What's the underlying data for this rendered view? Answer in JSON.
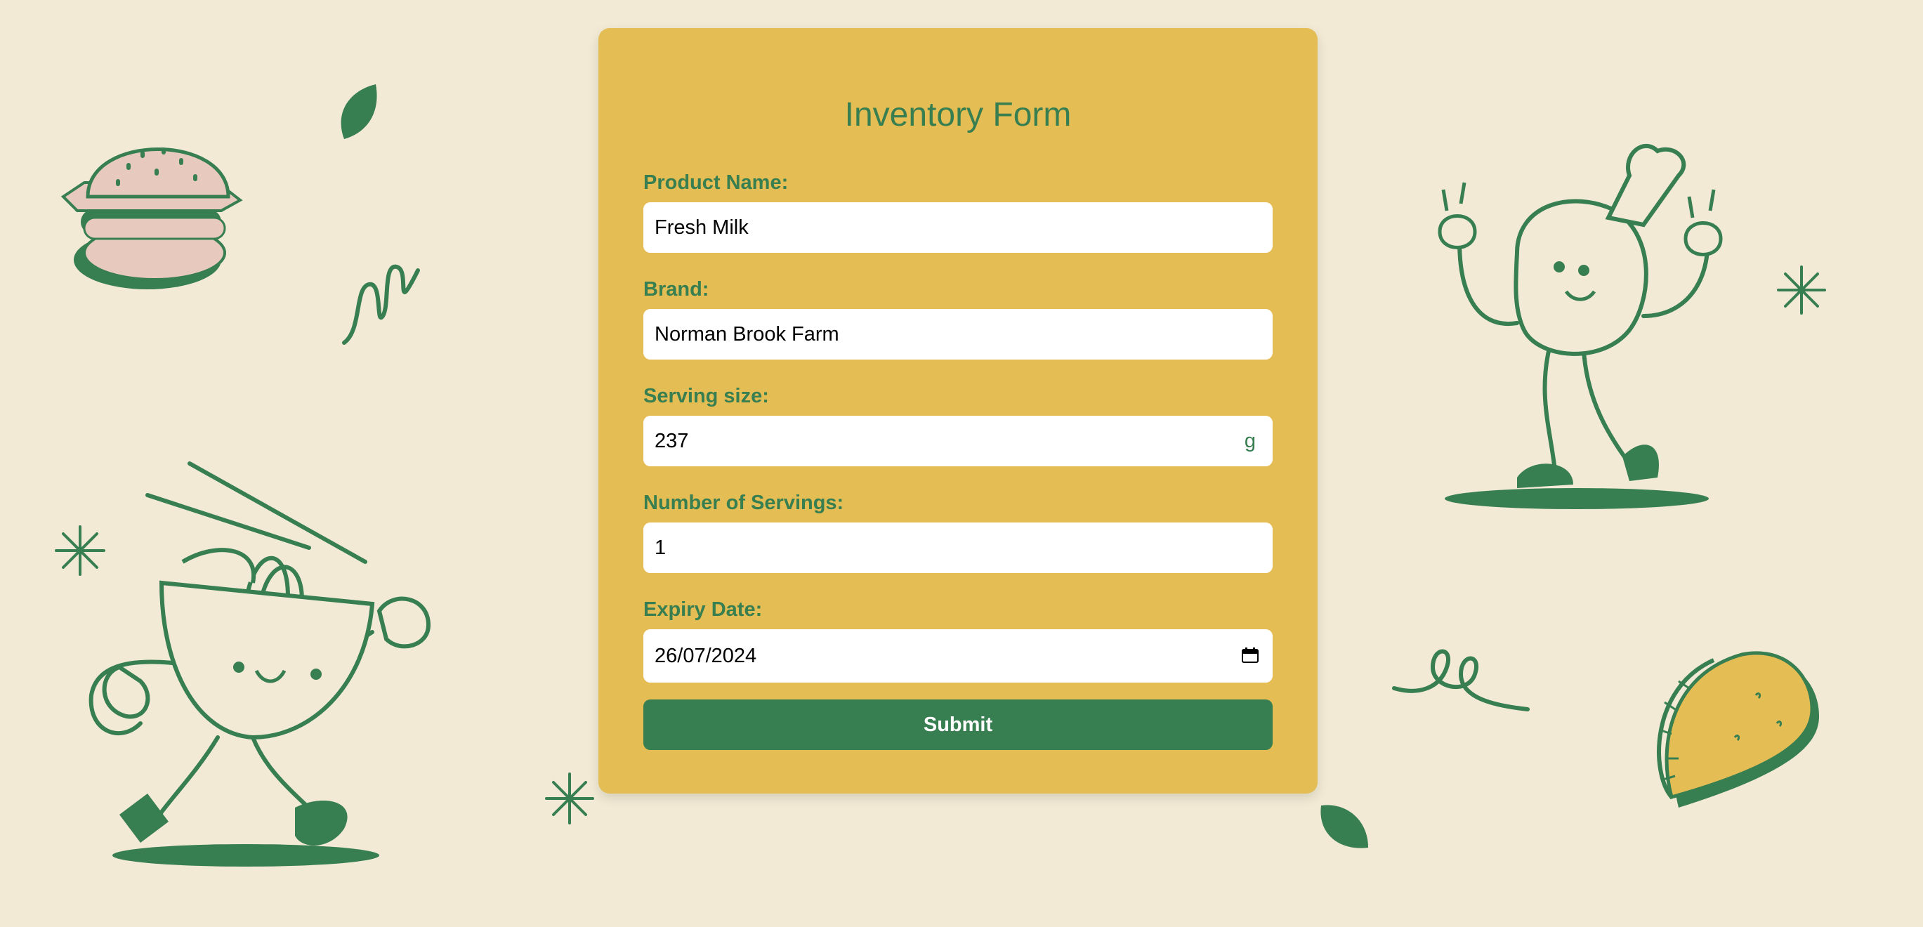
{
  "form": {
    "title": "Inventory Form",
    "fields": {
      "product_name": {
        "label": "Product Name:",
        "value": "Fresh Milk"
      },
      "brand": {
        "label": "Brand:",
        "value": "Norman Brook Farm"
      },
      "serving_size": {
        "label": "Serving size:",
        "value": "237",
        "unit": "g"
      },
      "servings": {
        "label": "Number of Servings:",
        "value": "1"
      },
      "expiry": {
        "label": "Expiry Date:",
        "value": "26/07/2024",
        "icon": "calendar-icon"
      }
    },
    "submit_label": "Submit"
  },
  "theme": {
    "background": "#f2ead4",
    "card": "#e5bd55",
    "accent": "#377e50",
    "bun": "#e8c9bd"
  },
  "decorations": [
    "burger-illustration",
    "leaf-icon",
    "squiggle-icon",
    "sparkle-icon",
    "noodle-bowl-character-illustration",
    "chicken-leg-character-illustration",
    "taco-illustration"
  ]
}
